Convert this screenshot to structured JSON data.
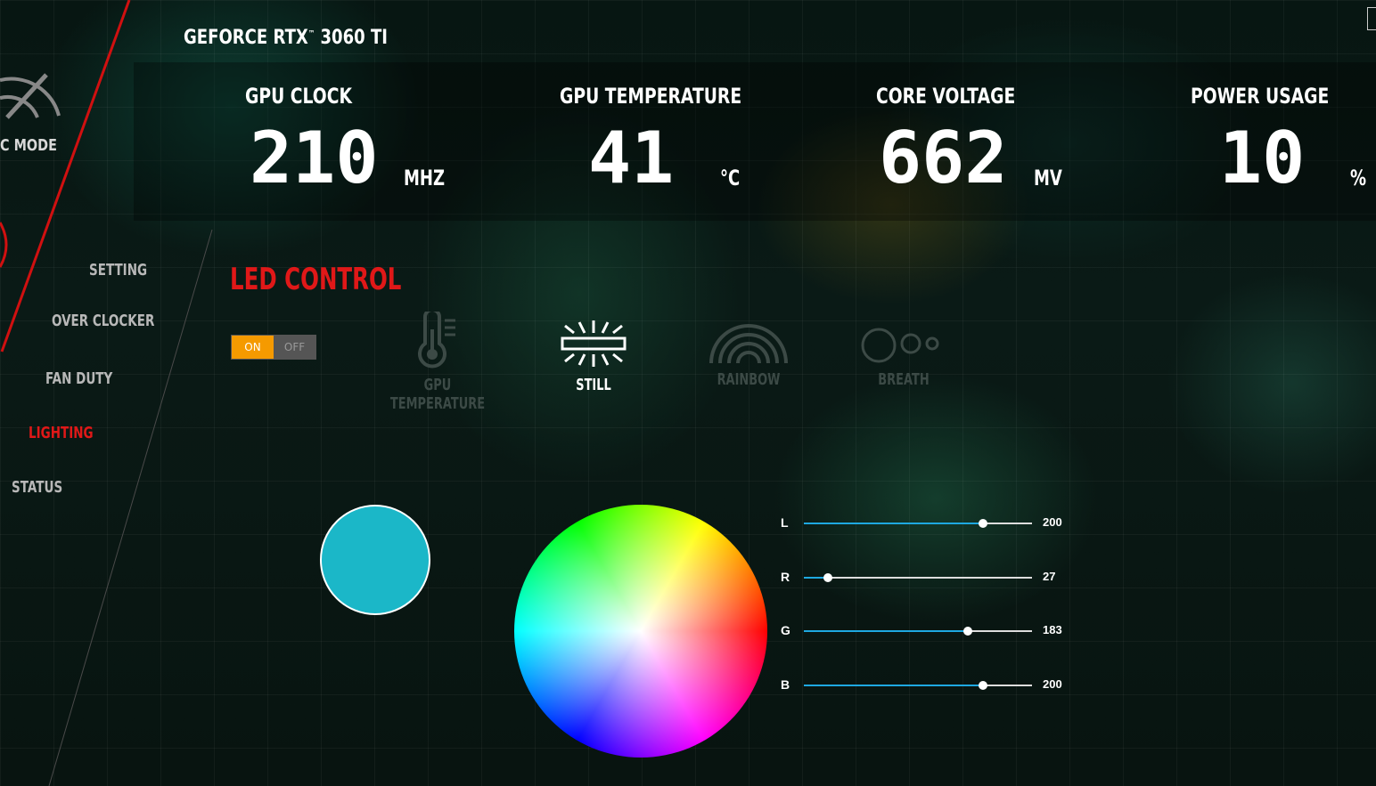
{
  "window": {
    "title": "GEFORCE RTX",
    "title_tm": "™",
    "title_model": " 3060 TI"
  },
  "stats": [
    {
      "label": "GPU CLOCK",
      "value": "210",
      "unit": "MHZ"
    },
    {
      "label": "GPU TEMPERATURE",
      "value": "41",
      "unit": "°C"
    },
    {
      "label": "CORE VOLTAGE",
      "value": "662",
      "unit": "MV"
    },
    {
      "label": "POWER USAGE",
      "value": "10",
      "unit": "%"
    }
  ],
  "sidebar": {
    "mode_label": "C MODE",
    "items": [
      {
        "label": "SETTING",
        "active": false
      },
      {
        "label": "OVER CLOCKER",
        "active": false
      },
      {
        "label": "FAN DUTY",
        "active": false
      },
      {
        "label": "LIGHTING",
        "active": true
      },
      {
        "label": "STATUS",
        "active": false
      }
    ]
  },
  "led": {
    "title": "LED CONTROL",
    "toggle_on": "ON",
    "toggle_off": "OFF",
    "toggle_state": "on",
    "modes": [
      {
        "label": "GPU TEMPERATURE",
        "icon": "thermometer-icon",
        "selected": false
      },
      {
        "label": "STILL",
        "icon": "still-light-icon",
        "selected": true
      },
      {
        "label": "RAINBOW",
        "icon": "rainbow-icon",
        "selected": false
      },
      {
        "label": "BREATH",
        "icon": "breath-icon",
        "selected": false
      }
    ],
    "current_color": "#1bb7c8"
  },
  "sliders": [
    {
      "label": "L",
      "value": 200,
      "max": 255,
      "display": "200"
    },
    {
      "label": "R",
      "value": 27,
      "max": 255,
      "display": "27"
    },
    {
      "label": "G",
      "value": 183,
      "max": 255,
      "display": "183"
    },
    {
      "label": "B",
      "value": 200,
      "max": 255,
      "display": "200"
    }
  ],
  "colors": {
    "accent_red": "#e01818",
    "toggle_on": "#f59a00",
    "slider_fill": "#1ea8e0"
  }
}
